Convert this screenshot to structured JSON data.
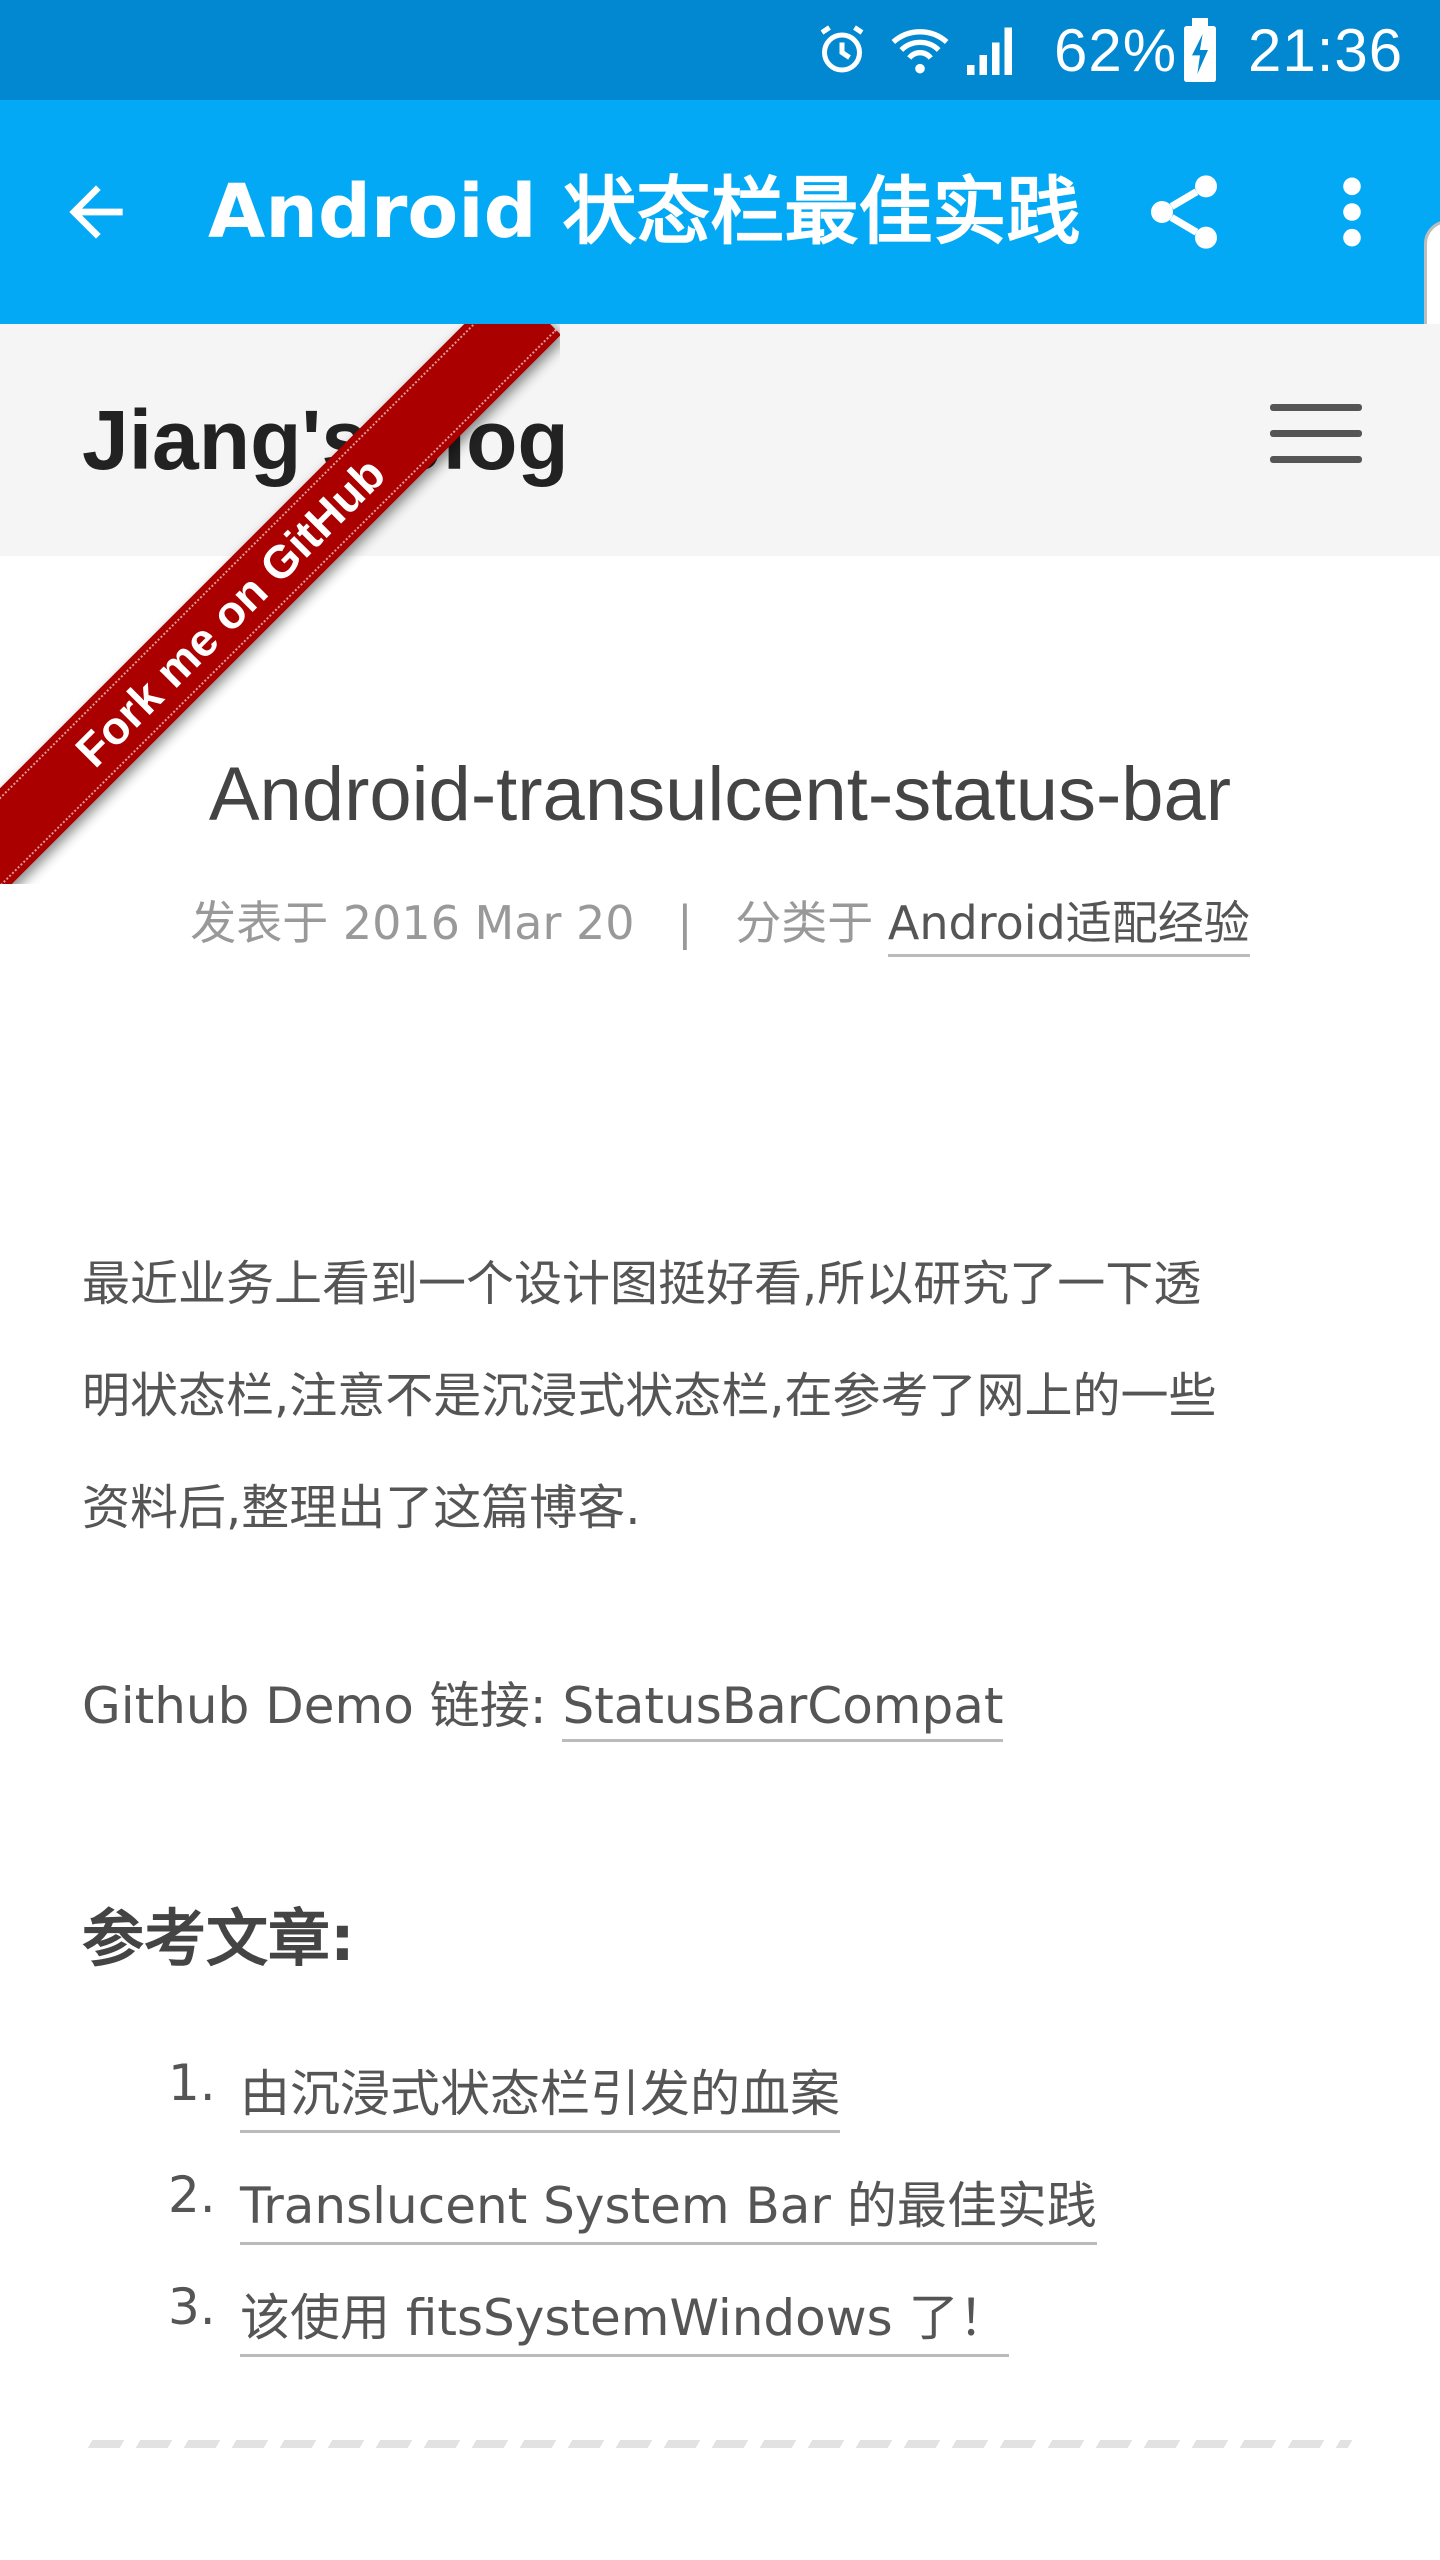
{
  "status_bar": {
    "icons": [
      "alarm-icon",
      "wifi-icon",
      "signal-icon",
      "battery-charging-icon"
    ],
    "battery": "62%",
    "time": "21:36"
  },
  "toolbar": {
    "title": "Android 状态栏最佳实践",
    "icons": [
      "back-arrow-icon",
      "share-icon",
      "more-vert-icon"
    ],
    "color": "#03a9f4"
  },
  "blog_header": {
    "title": "Jiang's blog",
    "menu_icon": "hamburger-menu-icon"
  },
  "ribbon": {
    "text": "Fork me on GitHub",
    "color": "#aa0000"
  },
  "post": {
    "title": "Android-transulcent-status-bar",
    "meta": {
      "posted_label": "发表于 2016 Mar 20",
      "separator": "|",
      "category_prefix": "分类于",
      "category": "Android适配经验"
    },
    "intro_lines": [
      "最近业务上看到一个设计图挺好看,所以研究了一下透",
      "明状态栏,注意不是沉浸式状态栏,在参考了网上的一些",
      "资料后,整理出了这篇博客."
    ],
    "demo_prefix": "Github Demo 链接: ",
    "demo_link": "StatusBarCompat",
    "references_heading": "参考文章:",
    "references": [
      {
        "num": "1.",
        "text": "由沉浸式状态栏引发的血案"
      },
      {
        "num": "2.",
        "text": "Translucent System Bar 的最佳实践"
      },
      {
        "num": "3.",
        "text": "该使用 fitsSystemWindows 了！"
      }
    ]
  }
}
